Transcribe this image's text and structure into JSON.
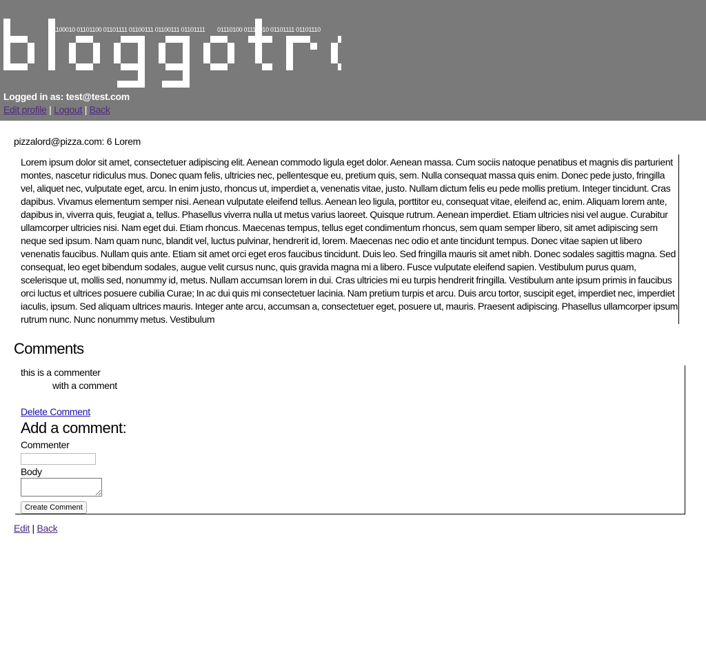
{
  "header": {
    "logo_text": "bloggotron",
    "binary_left": "01100010 01101100 01101111 01100111 01100111 01101111",
    "binary_right": "01110100 01110010 01101111 01101110",
    "logged_in_text": "Logged in as: test@test.com",
    "nav": {
      "edit_profile": "Edit profile",
      "logout": "Logout",
      "back": "Back",
      "separator": "|"
    },
    "colors": {
      "background": "#7a7a7a",
      "logo": "#ffffff",
      "visited_link": "#4b2a82"
    }
  },
  "post": {
    "title_line": "pizzalord@pizza.com: 6 Lorem",
    "body": "Lorem ipsum dolor sit amet, consectetuer adipiscing elit. Aenean commodo ligula eget dolor. Aenean massa. Cum sociis natoque penatibus et magnis dis parturient montes, nascetur ridiculus mus. Donec quam felis, ultricies nec, pellentesque eu, pretium quis, sem. Nulla consequat massa quis enim. Donec pede justo, fringilla vel, aliquet nec, vulputate eget, arcu. In enim justo, rhoncus ut, imperdiet a, venenatis vitae, justo. Nullam dictum felis eu pede mollis pretium. Integer tincidunt. Cras dapibus. Vivamus elementum semper nisi. Aenean vulputate eleifend tellus. Aenean leo ligula, porttitor eu, consequat vitae, eleifend ac, enim. Aliquam lorem ante, dapibus in, viverra quis, feugiat a, tellus. Phasellus viverra nulla ut metus varius laoreet. Quisque rutrum. Aenean imperdiet. Etiam ultricies nisi vel augue. Curabitur ullamcorper ultricies nisi. Nam eget dui. Etiam rhoncus. Maecenas tempus, tellus eget condimentum rhoncus, sem quam semper libero, sit amet adipiscing sem neque sed ipsum. Nam quam nunc, blandit vel, luctus pulvinar, hendrerit id, lorem. Maecenas nec odio et ante tincidunt tempus. Donec vitae sapien ut libero venenatis faucibus. Nullam quis ante. Etiam sit amet orci eget eros faucibus tincidunt. Duis leo. Sed fringilla mauris sit amet nibh. Donec sodales sagittis magna. Sed consequat, leo eget bibendum sodales, augue velit cursus nunc, quis gravida magna mi a libero. Fusce vulputate eleifend sapien. Vestibulum purus quam, scelerisque ut, mollis sed, nonummy id, metus. Nullam accumsan lorem in dui. Cras ultricies mi eu turpis hendrerit fringilla. Vestibulum ante ipsum primis in faucibus orci luctus et ultrices posuere cubilia Curae; In ac dui quis mi consectetuer lacinia. Nam pretium turpis et arcu. Duis arcu tortor, suscipit eget, imperdiet nec, imperdiet iaculis, ipsum. Sed aliquam ultrices mauris. Integer ante arcu, accumsan a, consectetuer eget, posuere ut, mauris. Praesent adipiscing. Phasellus ullamcorper ipsum rutrum nunc. Nunc nonummy metus. Vestibulum"
  },
  "comments": {
    "heading": "Comments",
    "items": [
      {
        "commenter": "this is a commenter",
        "body": "with a comment",
        "delete_label": "Delete Comment"
      }
    ],
    "form": {
      "heading": "Add a comment:",
      "commenter_label": "Commenter",
      "commenter_value": "",
      "body_label": "Body",
      "body_value": "",
      "submit_label": "Create Comment"
    }
  },
  "footer": {
    "edit": "Edit",
    "back": "Back",
    "separator": "|"
  }
}
